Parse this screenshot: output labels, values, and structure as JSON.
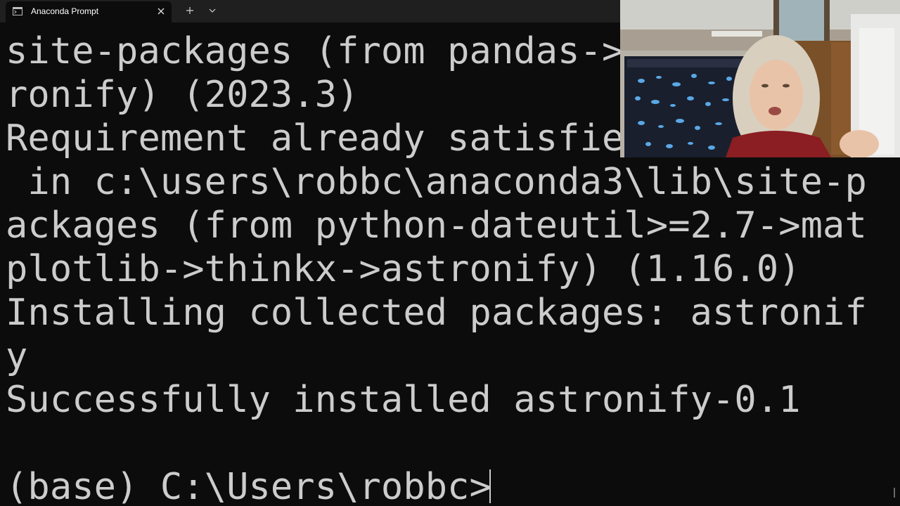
{
  "tab": {
    "title": "Anaconda Prompt",
    "icon": "terminal-icon",
    "close_icon": "close-icon",
    "new_tab_icon": "plus-icon",
    "dropdown_icon": "chevron-down-icon"
  },
  "terminal": {
    "lines": [
      "site-packages (from pandas->",
      "ronify) (2023.3)",
      "Requirement already satisfie",
      " in c:\\users\\robbc\\anaconda3\\lib\\site-p",
      "ackages (from python-dateutil>=2.7->mat",
      "plotlib->thinkx->astronify) (1.16.0)",
      "Installing collected packages: astronif",
      "y",
      "Successfully installed astronify-0.1",
      "",
      "(base) C:\\Users\\robbc>"
    ],
    "foreground": "#cccccc",
    "background": "#0c0c0c"
  }
}
